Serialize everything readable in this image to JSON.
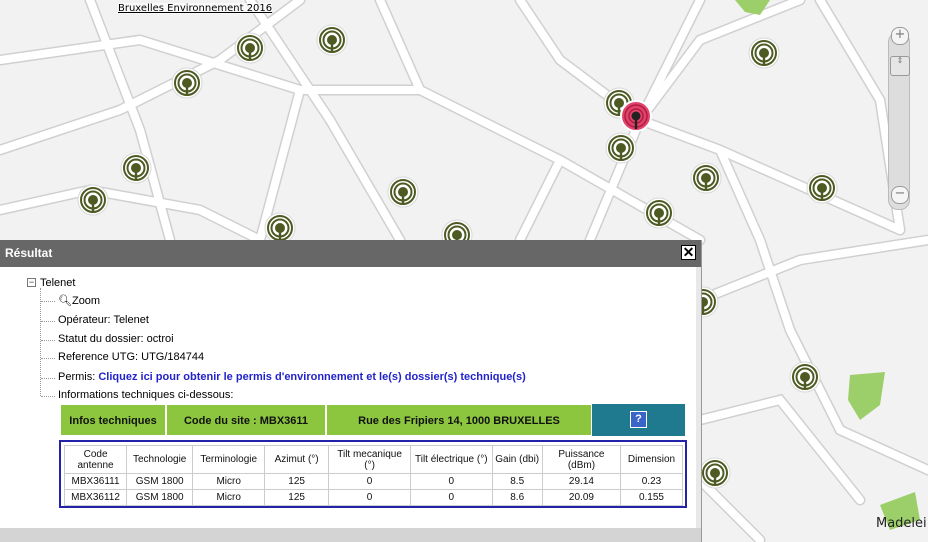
{
  "map": {
    "attribution": "Bruxelles Environnement 2016",
    "label_street": "Madelei",
    "zoom_in": "+",
    "zoom_out": "−",
    "zoom_handle": "⇕",
    "colors": {
      "background": "#f2f2f2",
      "road": "#ffffff",
      "park": "#9ccf6a",
      "marker": "#4d5a22",
      "selected_marker": "#e1436a"
    }
  },
  "panel": {
    "title": "Résultat",
    "close": "✕",
    "tree_root": "Telenet",
    "zoom_label": "Zoom",
    "operator_label": "Opérateur: Telenet",
    "status_label": "Statut du dossier: octroi",
    "reference_label": "Reference UTG: UTG/184744",
    "permis_prefix": "Permis: ",
    "permis_link": "Cliquez ici pour obtenir le permis d'environnement et le(s) dossier(s) technique(s)",
    "info_label": "Informations techniques ci-dessous:",
    "infobar": {
      "infos": "Infos techniques",
      "site_code": "Code du site : MBX3611",
      "address": "Rue des Fripiers 14, 1000 BRUXELLES",
      "help": "?"
    },
    "table": {
      "headers": [
        "Code antenne",
        "Technologie",
        "Terminologie",
        "Azimut (°)",
        "Tilt mecanique (°)",
        "Tilt électrique (°)",
        "Gain (dbi)",
        "Puissance (dBm)",
        "Dimension"
      ],
      "rows": [
        [
          "MBX36111",
          "GSM 1800",
          "Micro",
          "125",
          "0",
          "0",
          "8.5",
          "29.14",
          "0.23"
        ],
        [
          "MBX36112",
          "GSM 1800",
          "Micro",
          "125",
          "0",
          "0",
          "8.6",
          "20.09",
          "0.155"
        ]
      ]
    }
  }
}
